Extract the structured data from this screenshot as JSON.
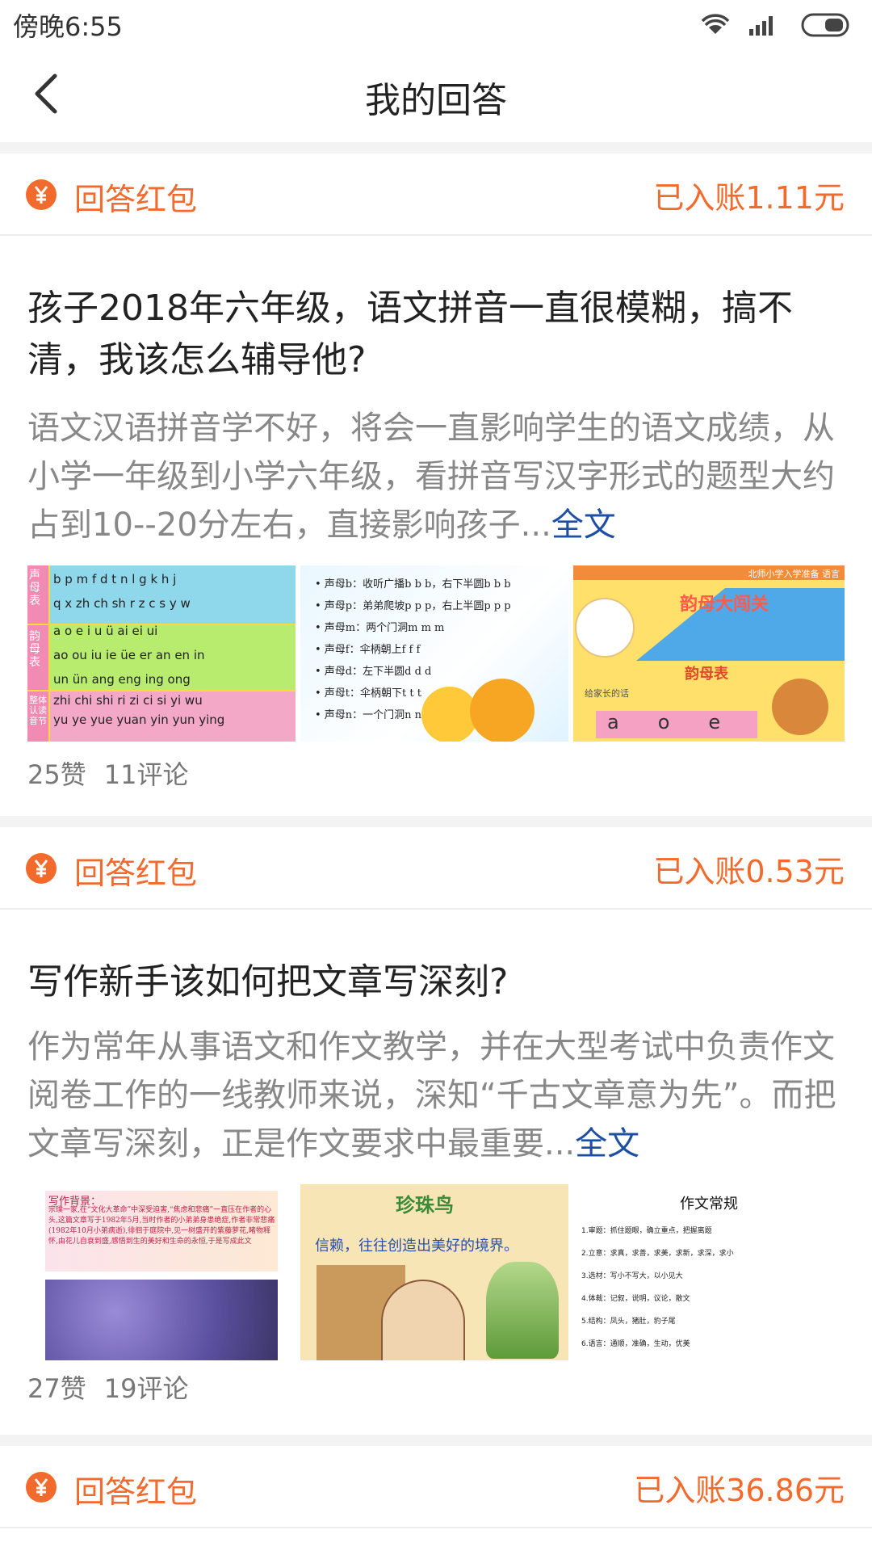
{
  "status": {
    "time": "傍晚6:55"
  },
  "header": {
    "title": "我的回答"
  },
  "cards": [
    {
      "reward_label": "回答红包",
      "reward_amount": "已入账1.11元",
      "title": "孩子2018年六年级，语文拼音一直很模糊，搞不清，我该怎么辅导他?",
      "excerpt": "语文汉语拼音学不好，将会一直影响学生的语文成绩，从小学一年级到小学六年级，看拼音写汉字形式的题型大约占到10--20分左右，直接影响孩子...",
      "more": "全文",
      "likes": "25赞",
      "comments": "11评论",
      "images": [
        {
          "caption_rows": [
            "b p m f d t n l g k h j",
            "q x zh ch sh r z c s y w",
            "a o e i u ü ai ei ui",
            "ao ou iu ie üe er an en in",
            "un ün ang eng ing ong",
            "zhi chi shi ri zi ci si yi wu",
            "yu ye yue yuan yin yun ying"
          ],
          "side_labels": [
            "声母表",
            "韵母表",
            "整体认读音节"
          ]
        },
        {
          "lines": [
            "• 声母b：收听广播b b b，右下半圆b b b",
            "• 声母p：弟弟爬坡p p p，右上半圆p p p",
            "• 声母m：两个门洞m m m",
            "• 声母f：伞柄朝上f f f",
            "• 声母d：左下半圆d d d",
            "• 声母t：伞柄朝下t t t",
            "• 声母n：一个门洞n n n"
          ]
        },
        {
          "header": "北师小学入学准备 语言",
          "title": "韵母大闯关",
          "subtitle": "韵母表",
          "note": "给家长的话",
          "letters": [
            "a",
            "o",
            "e"
          ]
        }
      ]
    },
    {
      "reward_label": "回答红包",
      "reward_amount": "已入账0.53元",
      "title": "写作新手该如何把文章写深刻?",
      "excerpt": "作为常年从事语文和作文教学，并在大型考试中负责作文阅卷工作的一线教师来说，深知“千古文章意为先”。而把文章写深刻，正是作文要求中最重要...",
      "more": "全文",
      "likes": "27赞",
      "comments": "19评论",
      "images": [
        {
          "heading": "写作背景：",
          "text": "宗璞一家,在“文化大革命”中深受迫害,“焦虑和悲痛”一直压在作者的心头,这篇文章写于1982年5月,当时作者的小弟弟身患绝症,作者非常悲痛(1982年10月小弟病逝),徘徊于庭院中,见一树盛开的紫藤萝花,睹物释怀,由花儿自衰到盛,感悟到生的美好和生命的永恒,于是写成此文"
        },
        {
          "title": "珍珠鸟",
          "line": "信赖，往往创造出美好的境界。"
        },
        {
          "title": "作文常规",
          "items": [
            "1.审题：抓住题眼，确立重点，把握离题",
            "2.立意：求真，求善，求美，求新，求深，求小",
            "3.选材：写小不写大，以小见大",
            "4.体裁：记叙，说明，议论，散文",
            "5.结构：凤头，猪肚，豹子尾",
            "6.语言：通顺，准确，生动，优美"
          ]
        }
      ]
    },
    {
      "reward_label": "回答红包",
      "reward_amount": "已入账36.86元"
    }
  ]
}
